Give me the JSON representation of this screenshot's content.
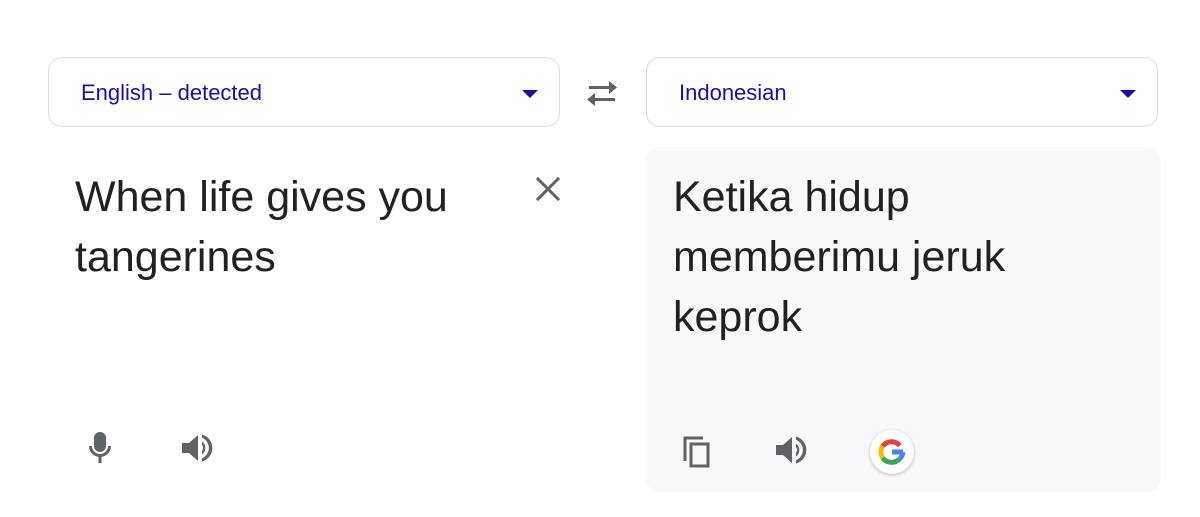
{
  "source": {
    "language_label": "English – detected",
    "text": "When life gives you tangerines"
  },
  "target": {
    "language_label": "Indonesian",
    "text": "Ketika hidup memberimu jeruk keprok"
  },
  "icons": {
    "language_caret": "dropdown-caret-icon",
    "swap": "swap-languages-icon",
    "clear": "close-icon",
    "microphone": "microphone-icon",
    "speaker": "speaker-icon",
    "copy": "copy-icon",
    "google": "google-g-icon"
  },
  "colors": {
    "language_link": "#1a0dab",
    "icon_gray": "#5f6368",
    "text": "#202124",
    "target_panel_bg": "#f8f9fa",
    "border": "#dadce0"
  }
}
